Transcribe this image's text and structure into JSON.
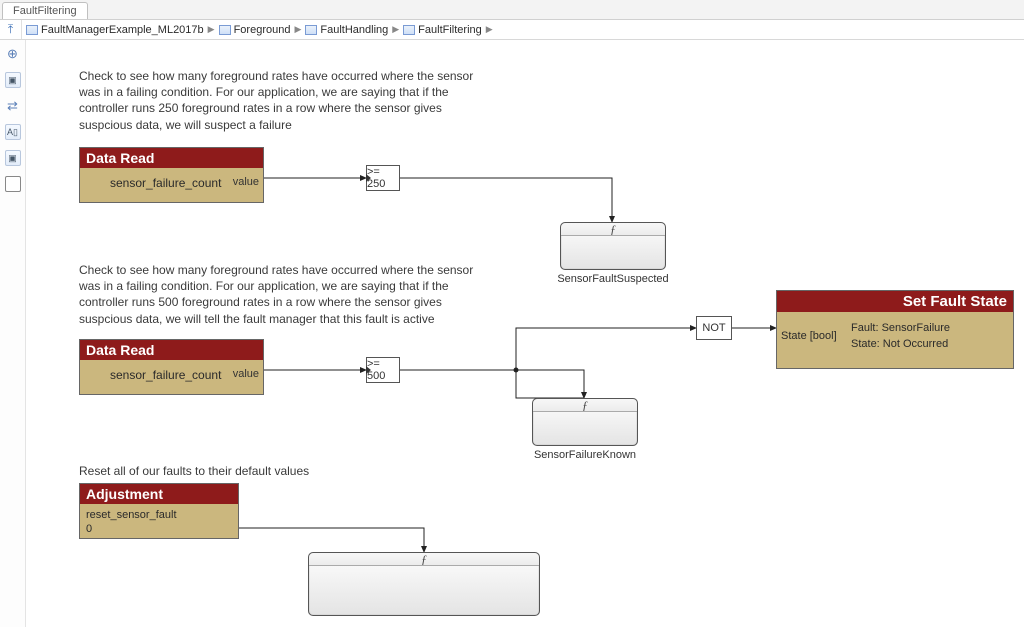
{
  "tab": {
    "title": "FaultFiltering"
  },
  "breadcrumb": {
    "items": [
      {
        "label": "FaultManagerExample_ML2017b"
      },
      {
        "label": "Foreground"
      },
      {
        "label": "FaultHandling"
      },
      {
        "label": "FaultFiltering"
      }
    ]
  },
  "tools": {
    "nav_up_icon": "⤒",
    "zoom_icon": "⊕",
    "fit_icon": "▣",
    "swap_icon": "⇄",
    "annotate_icon": "A▯",
    "image_icon": "▣",
    "region_icon": "□"
  },
  "notes": {
    "n1": "Check to see how many foreground rates have occurred where the sensor was in a failing condition. For our application, we are saying that if the controller runs 250 foreground rates in a row where the sensor gives suspcious data, we will suspect a failure",
    "n2": "Check to see how many foreground rates have occurred where the sensor was in a failing condition. For our application, we are saying that if the controller runs 500 foreground rates in a row where the sensor gives suspcious data, we will tell the fault manager that this fault is active",
    "n3": "Reset all of our faults to their default values"
  },
  "blocks": {
    "read1": {
      "header": "Data Read",
      "signal": "sensor_failure_count",
      "port": "value"
    },
    "read2": {
      "header": "Data Read",
      "signal": "sensor_failure_count",
      "port": "value"
    },
    "adj": {
      "header": "Adjustment",
      "line1": "reset_sensor_fault",
      "line2": "0"
    },
    "cmp1": {
      "label": ">= 250"
    },
    "cmp2": {
      "label": ">= 500"
    },
    "not": {
      "label": "NOT"
    },
    "setfault": {
      "header": "Set Fault State",
      "port": "State [bool]",
      "line1": "Fault: SensorFailure",
      "line2": "State: Not Occurred"
    },
    "sub1_label": "SensorFaultSuspected",
    "sub2_label": "SensorFailureKnown",
    "f_glyph": "ƒ"
  },
  "colors": {
    "header": "#8e1b1b",
    "body": "#cbb77e"
  }
}
